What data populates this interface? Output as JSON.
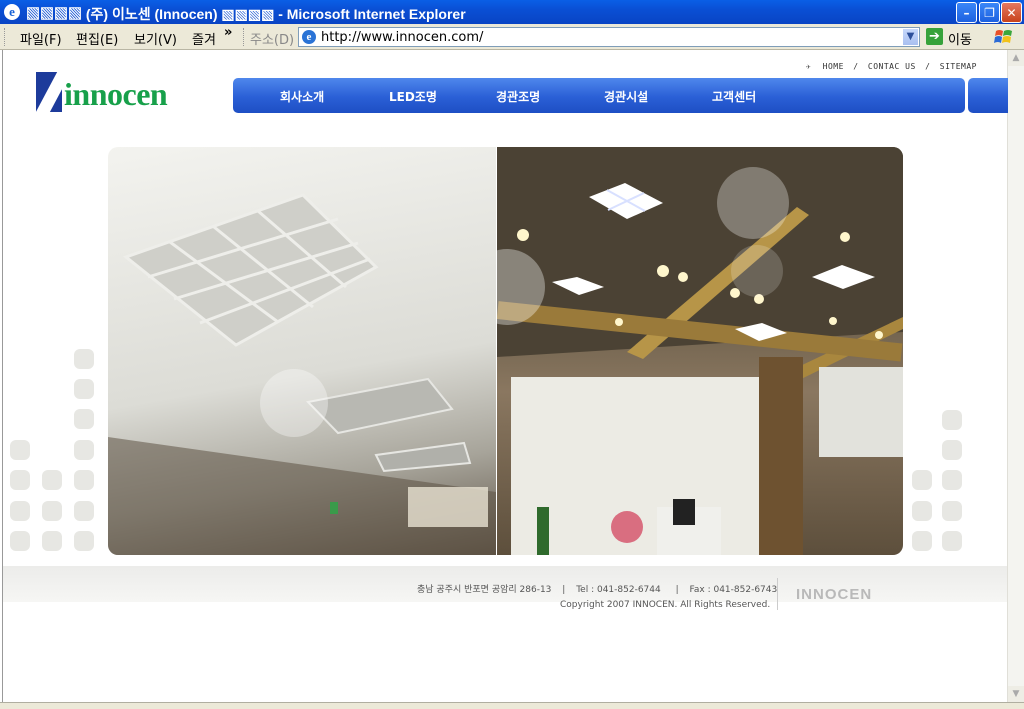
{
  "window": {
    "title": "▧▧▧▧ (주) 이노센 (Innocen) ▧▧▧▧ - Microsoft Internet Explorer",
    "minimize": "–",
    "restore": "❐",
    "close": "✕"
  },
  "menu": {
    "file": "파일(F)",
    "edit": "편집(E)",
    "view": "보기(V)",
    "favorites": "즐겨",
    "more": "»"
  },
  "address": {
    "label": "주소(D)",
    "url": "http://www.innocen.com/",
    "go_label": "이동"
  },
  "site": {
    "toplinks": {
      "home": "HOME",
      "contact": "CONTAC US",
      "sitemap": "SITEMAP",
      "sep": "/"
    },
    "logo_text": "innocen",
    "nav": [
      {
        "label": "회사소개"
      },
      {
        "label": "LED조명"
      },
      {
        "label": "경관조명"
      },
      {
        "label": "경관시설"
      },
      {
        "label": "고객센터"
      }
    ],
    "footer": {
      "address": "충남 공주시 반포면 공암리 286-13",
      "tel": "Tel : 041-852-6744",
      "fax": "Fax : 041-852-6743",
      "copyright": "Copyright 2007 INNOCEN. All Rights Reserved.",
      "brand": "INNOCEN",
      "sep": "|"
    }
  },
  "colors": {
    "titlebar": "#0a4fd4",
    "nav": "#2a5fd6",
    "logo_green": "#17a04a",
    "logo_blue": "#1d3b9b"
  }
}
